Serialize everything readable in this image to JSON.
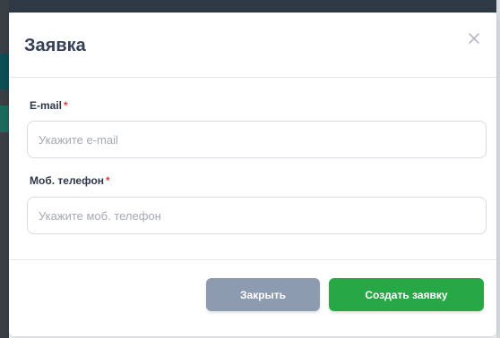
{
  "modal": {
    "title": "Заявка",
    "close_icon": "close-icon"
  },
  "form": {
    "email": {
      "label": "E-mail",
      "required_mark": "*",
      "value": "",
      "placeholder": "Укажите e-mail"
    },
    "phone": {
      "label": "Моб. телефон",
      "required_mark": "*",
      "value": "",
      "placeholder": "Укажите моб. телефон"
    }
  },
  "footer": {
    "close_label": "Закрыть",
    "create_label": "Создать заявку"
  },
  "colors": {
    "title": "#344055",
    "required": "#e53e3e",
    "close_button": "#8d9bb0",
    "create_button": "#27a745"
  }
}
